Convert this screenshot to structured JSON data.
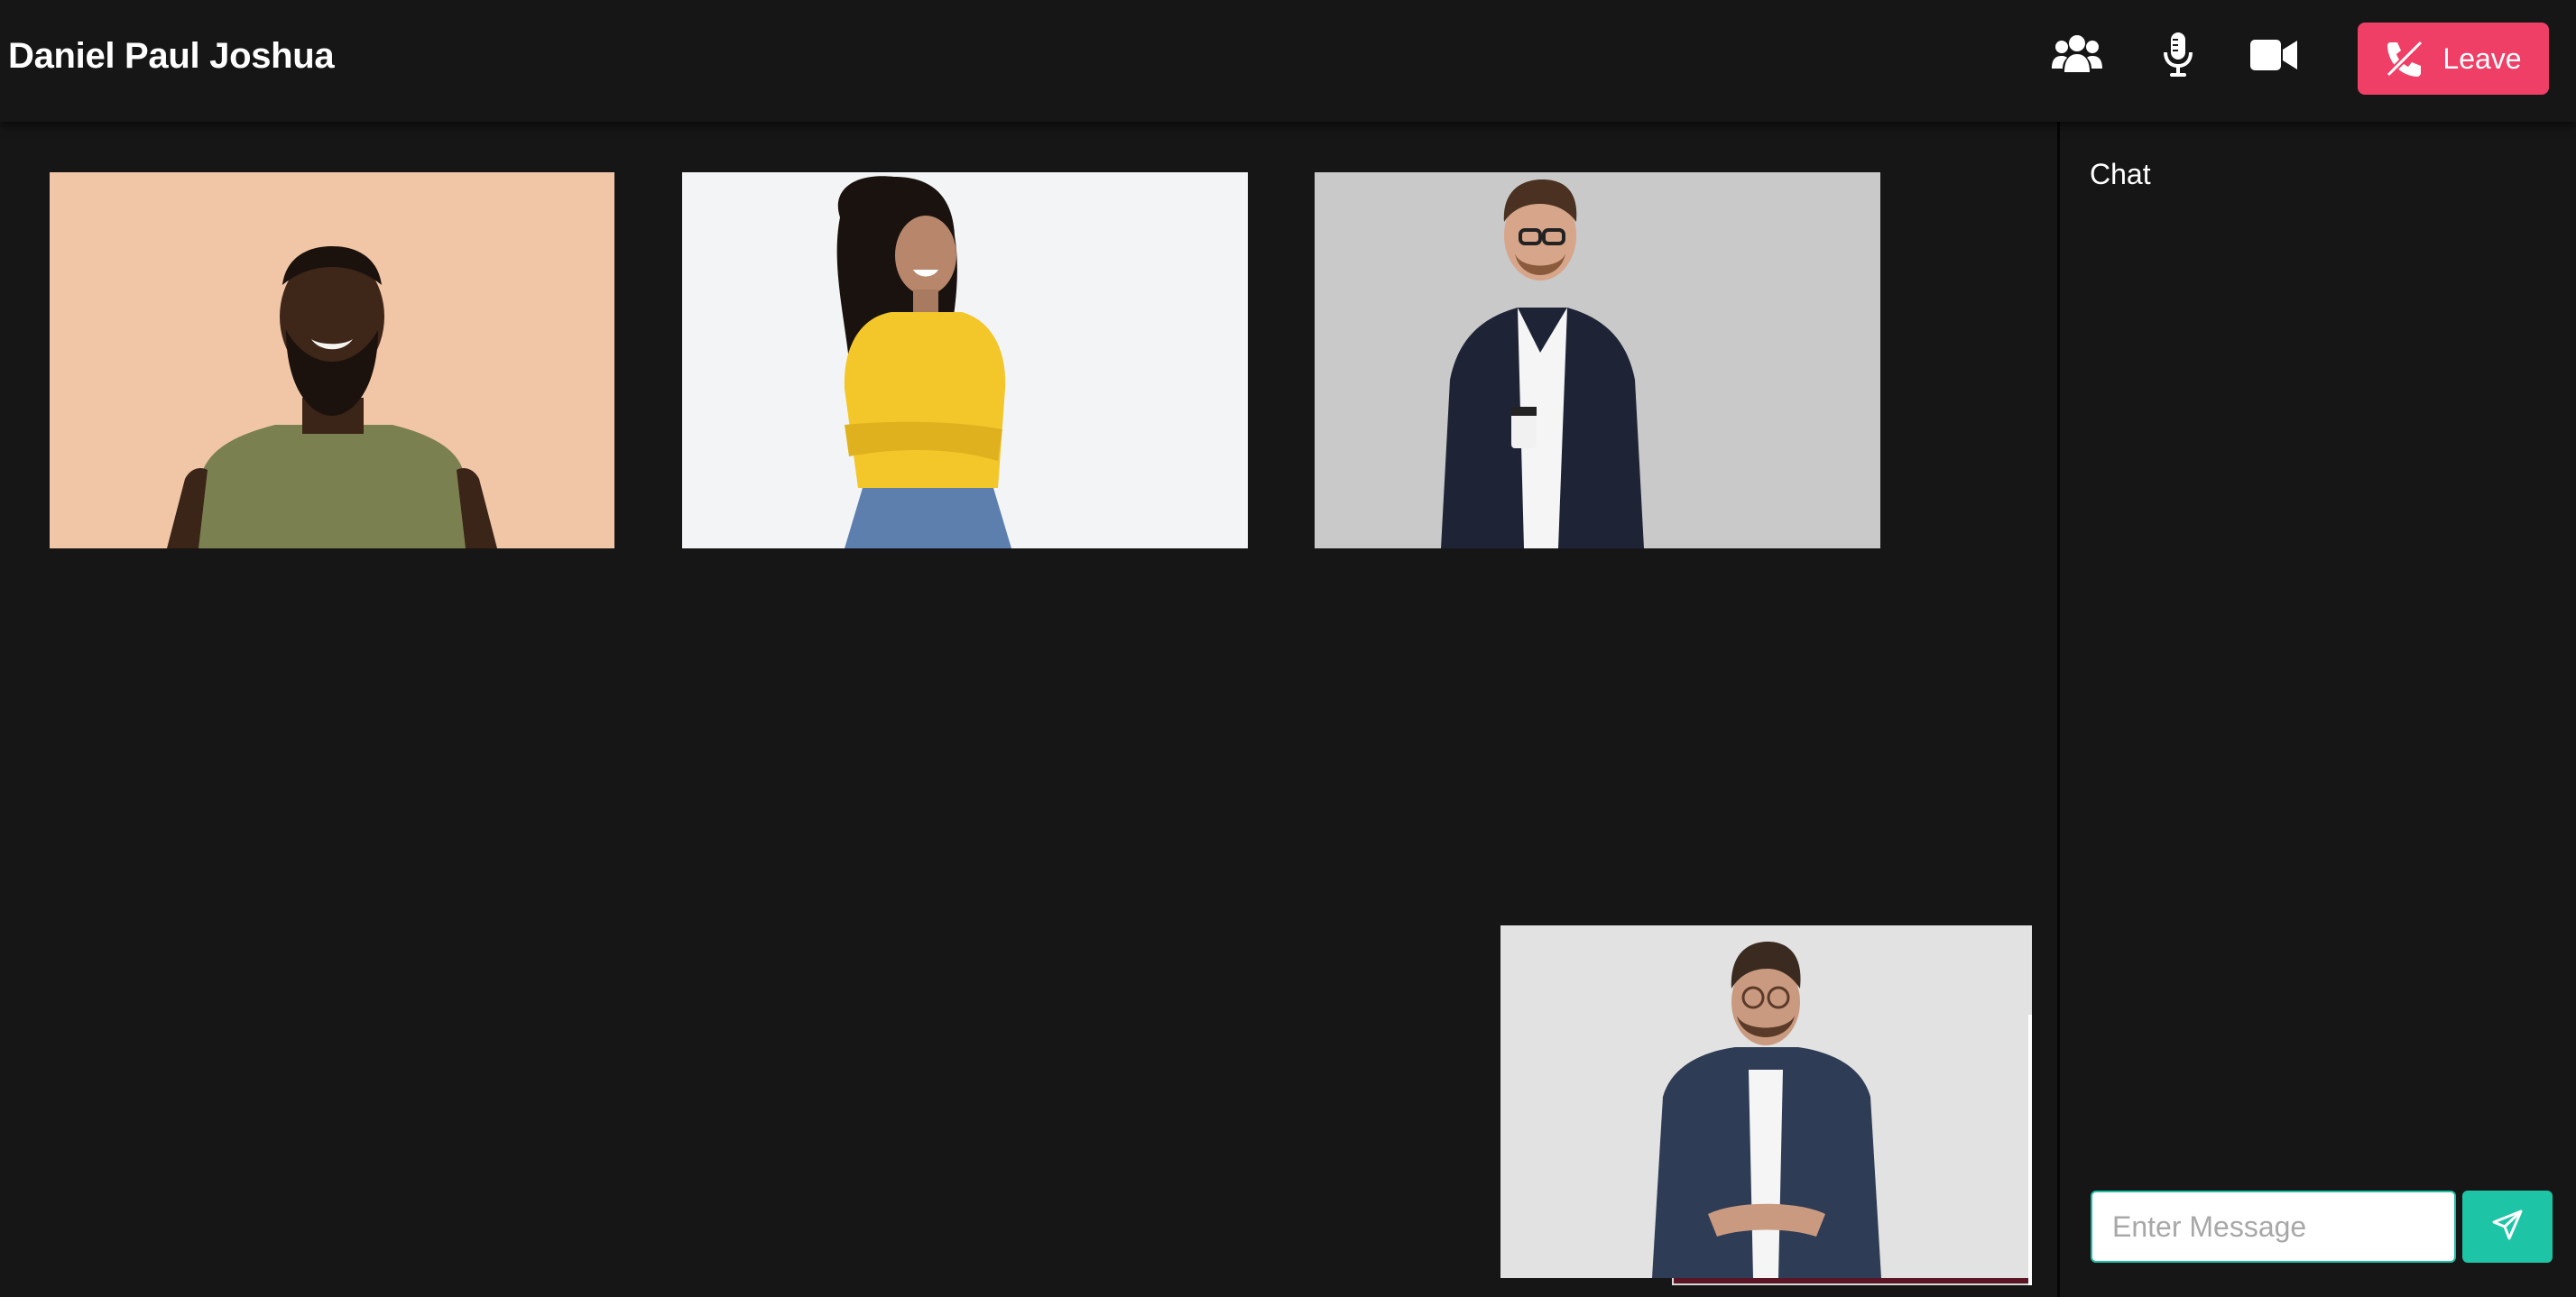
{
  "header": {
    "title": "Daniel Paul Joshua",
    "icons": [
      "people-icon",
      "microphone-icon",
      "video-camera-icon"
    ],
    "leave_label": "Leave",
    "leave_icon": "phone-hangup-icon"
  },
  "participants": [
    {
      "description_icon": "participant-video",
      "background": "#f1c6a6"
    },
    {
      "description_icon": "participant-video",
      "background": "#f3f4f6"
    },
    {
      "description_icon": "participant-video",
      "background": "#c9c9c9"
    }
  ],
  "self_view": {
    "background": "#e2e2e2"
  },
  "chat": {
    "title": "Chat",
    "input_placeholder": "Enter Message",
    "input_value": "",
    "send_icon": "send-icon"
  },
  "colors": {
    "background": "#171617",
    "leave_button": "#ef3f67",
    "send_button": "#1dc4a6",
    "input_border": "#1fbfa4"
  }
}
